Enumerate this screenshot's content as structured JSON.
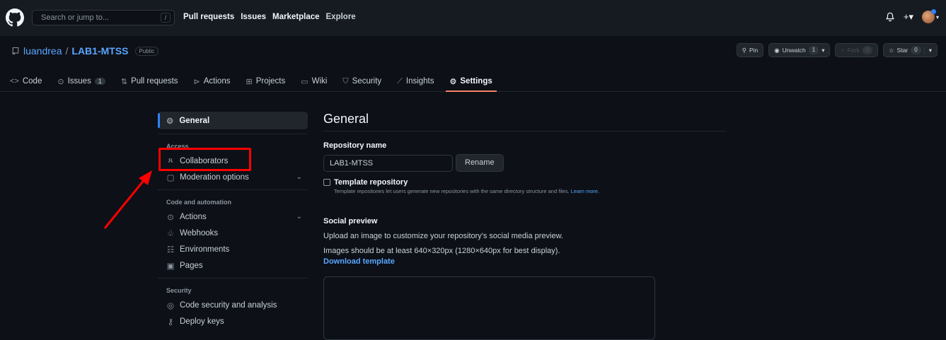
{
  "topbar": {
    "search_placeholder": "Search or jump to...",
    "slash_key": "/",
    "nav": [
      "Pull requests",
      "Issues",
      "Marketplace",
      "Explore"
    ],
    "bell_icon": "bell-icon",
    "plus_label": "+▾"
  },
  "repo": {
    "owner": "luandrea",
    "sep": "/",
    "name": "LAB1-MTSS",
    "visibility": "Public",
    "buttons": {
      "pin": "Pin",
      "unwatch": "Unwatch",
      "unwatch_count": "1",
      "fork": "Fork",
      "fork_count": "0",
      "star": "Star",
      "star_count": "0"
    }
  },
  "tabs": {
    "code": "Code",
    "issues": "Issues",
    "issues_count": "1",
    "pulls": "Pull requests",
    "actions": "Actions",
    "projects": "Projects",
    "wiki": "Wiki",
    "security": "Security",
    "insights": "Insights",
    "settings": "Settings"
  },
  "sidebar": {
    "general": "General",
    "access_heading": "Access",
    "collaborators": "Collaborators",
    "moderation": "Moderation options",
    "code_heading": "Code and automation",
    "actions": "Actions",
    "webhooks": "Webhooks",
    "environments": "Environments",
    "pages": "Pages",
    "security_heading": "Security",
    "code_security": "Code security and analysis",
    "deploy_keys": "Deploy keys"
  },
  "main": {
    "title": "General",
    "repo_name_label": "Repository name",
    "repo_name_value": "LAB1-MTSS",
    "rename_button": "Rename",
    "template_label": "Template repository",
    "template_hint": "Template repositories let users generate new repositories with the same directory structure and files.",
    "learn_more": "Learn more.",
    "social_title": "Social preview",
    "social_desc": "Upload an image to customize your repository's social media preview.",
    "social_size": "Images should be at least 640×320px (1280×640px for best display).",
    "download_template": "Download template"
  },
  "colors": {
    "accent": "#2f81f7",
    "selected_tab_underline": "#f78166",
    "annotation": "#ff0000"
  }
}
